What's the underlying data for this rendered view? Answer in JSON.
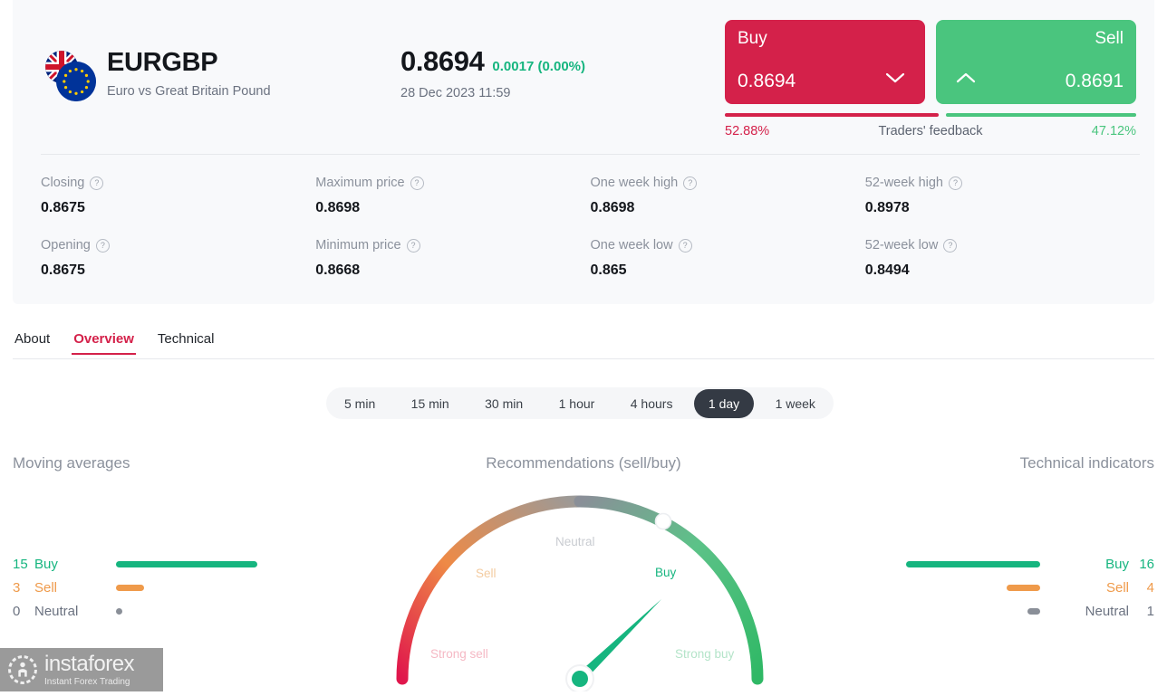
{
  "instrument": {
    "symbol": "EURGBP",
    "description": "Euro vs Great Britain Pound",
    "price": "0.8694",
    "change": "0.0017 (0.00%)",
    "timestamp": "28 Dec 2023 11:59",
    "flag_icon": "eur-gbp-flag-icon"
  },
  "trade": {
    "buy_label": "Buy",
    "buy_price": "0.8694",
    "sell_label": "Sell",
    "sell_price": "0.8691",
    "buy_chevron_icon": "chevron-down-icon",
    "sell_chevron_icon": "chevron-up-icon",
    "buy_color": "#d4214a",
    "sell_color": "#4ac57e"
  },
  "feedback": {
    "title": "Traders' feedback",
    "buy_pct": "52.88%",
    "sell_pct": "47.12%",
    "buy_value": 52.88,
    "sell_value": 47.12
  },
  "stats": [
    {
      "label": "Closing",
      "value": "0.8675",
      "help_icon": "question-mark-icon"
    },
    {
      "label": "Maximum price",
      "value": "0.8698",
      "help_icon": "question-mark-icon"
    },
    {
      "label": "One week high",
      "value": "0.8698",
      "help_icon": "question-mark-icon"
    },
    {
      "label": "52-week high",
      "value": "0.8978",
      "help_icon": "question-mark-icon"
    },
    {
      "label": "Opening",
      "value": "0.8675",
      "help_icon": "question-mark-icon"
    },
    {
      "label": "Minimum price",
      "value": "0.8668",
      "help_icon": "question-mark-icon"
    },
    {
      "label": "One week low",
      "value": "0.865",
      "help_icon": "question-mark-icon"
    },
    {
      "label": "52-week low",
      "value": "0.8494",
      "help_icon": "question-mark-icon"
    }
  ],
  "tabs": [
    {
      "label": "About",
      "active": false
    },
    {
      "label": "Overview",
      "active": true
    },
    {
      "label": "Technical",
      "active": false
    }
  ],
  "timeframes": [
    {
      "label": "5 min",
      "active": false
    },
    {
      "label": "15 min",
      "active": false
    },
    {
      "label": "30 min",
      "active": false
    },
    {
      "label": "1 hour",
      "active": false
    },
    {
      "label": "4 hours",
      "active": false
    },
    {
      "label": "1 day",
      "active": true
    },
    {
      "label": "1 week",
      "active": false
    }
  ],
  "moving_averages": {
    "title": "Moving averages",
    "rows": [
      {
        "count": "15",
        "name": "Buy",
        "value": 15,
        "color": "#16b57f"
      },
      {
        "count": "3",
        "name": "Sell",
        "value": 3,
        "color": "#ef9a4a"
      },
      {
        "count": "0",
        "name": "Neutral",
        "value": 0,
        "color": "#8a8f98"
      }
    ]
  },
  "technical_indicators": {
    "title": "Technical indicators",
    "rows": [
      {
        "count": "16",
        "name": "Buy",
        "value": 16,
        "color": "#16b57f"
      },
      {
        "count": "4",
        "name": "Sell",
        "value": 4,
        "color": "#ef9a4a"
      },
      {
        "count": "1",
        "name": "Neutral",
        "value": 1,
        "color": "#8a8f98"
      }
    ]
  },
  "chart_data": {
    "type": "gauge",
    "title": "Recommendations (sell/buy)",
    "zones": [
      "Strong sell",
      "Sell",
      "Neutral",
      "Buy",
      "Strong buy"
    ],
    "labels": {
      "strong_sell": "Strong sell",
      "sell": "Sell",
      "neutral": "Neutral",
      "buy": "Buy",
      "strong_buy": "Strong buy"
    },
    "needle_angle_deg": 50,
    "needle_value": "Buy",
    "marker_angle_deg": 62,
    "range": [
      -1,
      1
    ],
    "gradient_stops": [
      "#e0164c",
      "#ef9a4a",
      "#8a8f98",
      "#4ac57e",
      "#2fb865"
    ]
  },
  "logo": {
    "name": "instaforex",
    "tagline": "Instant Forex Trading",
    "icon": "instaforex-logo-icon"
  }
}
